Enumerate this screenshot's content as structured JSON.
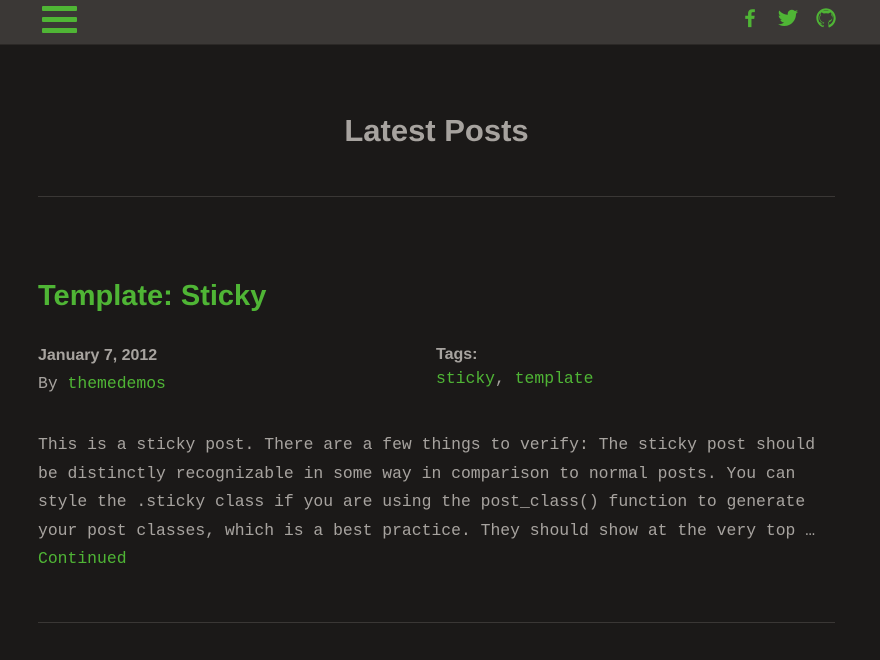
{
  "header": {
    "menu_icon": "hamburger-menu-icon",
    "accent_color": "#4fb535",
    "social": [
      {
        "name": "Facebook",
        "icon": "facebook-icon"
      },
      {
        "name": "Twitter",
        "icon": "twitter-icon"
      },
      {
        "name": "GitHub",
        "icon": "github-icon"
      }
    ]
  },
  "page": {
    "title": "Latest Posts"
  },
  "post": {
    "title": "Template: Sticky",
    "date": "January 7, 2012",
    "by_prefix": "By ",
    "author": "themedemos",
    "tags_label": "Tags:",
    "tags": [
      "sticky",
      "template"
    ],
    "tag_separator": ", ",
    "excerpt_lines": [
      "This is a sticky post. There are a few things to verify: The sticky post should",
      "be distinctly recognizable in some way in comparison to normal posts. You can",
      "style the .sticky class if you are using the post_class() function to generate",
      "your post classes, which is a best practice. They should show at the very top …"
    ],
    "continue_label": "Continued"
  }
}
